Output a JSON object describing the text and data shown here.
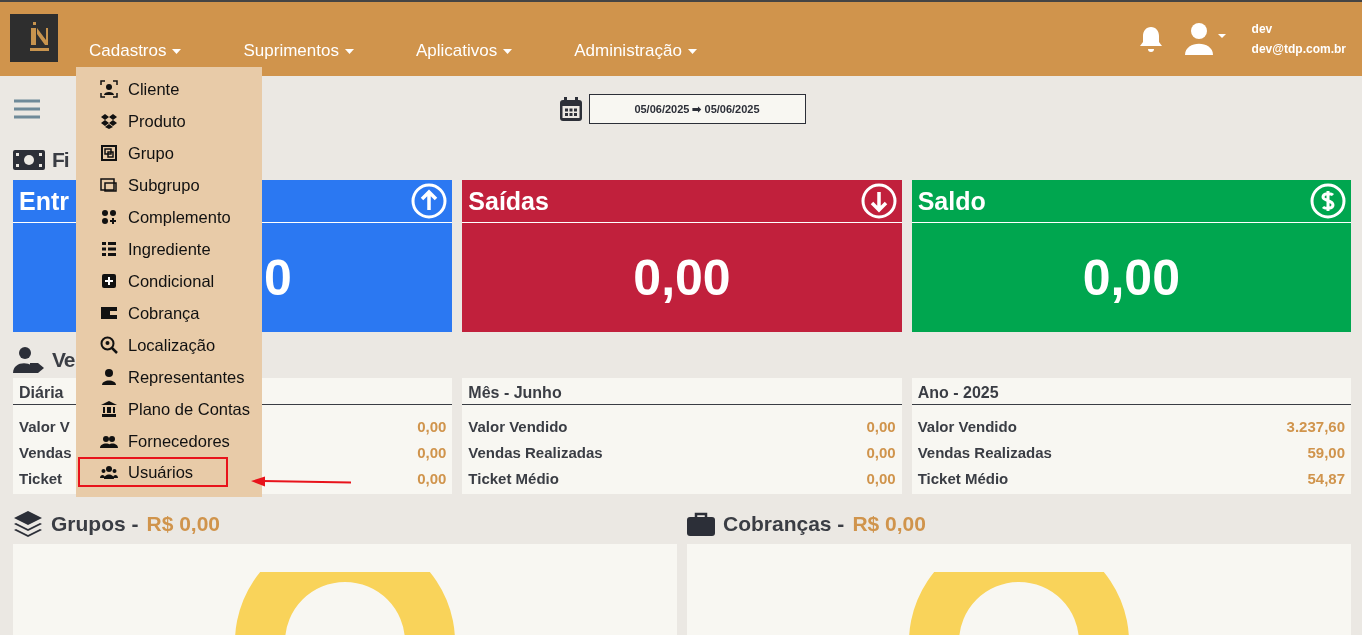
{
  "header": {
    "nav": [
      {
        "label": "Cadastros"
      },
      {
        "label": "Suprimentos"
      },
      {
        "label": "Aplicativos"
      },
      {
        "label": "Administração"
      }
    ],
    "user": {
      "name": "dev",
      "email": "dev@tdp.com.br"
    }
  },
  "menu": {
    "items": [
      {
        "label": "Cliente",
        "highlighted": false
      },
      {
        "label": "Produto",
        "highlighted": false
      },
      {
        "label": "Grupo",
        "highlighted": false
      },
      {
        "label": "Subgrupo",
        "highlighted": false
      },
      {
        "label": "Complemento",
        "highlighted": false
      },
      {
        "label": "Ingrediente",
        "highlighted": false
      },
      {
        "label": "Condicional",
        "highlighted": false
      },
      {
        "label": "Cobrança",
        "highlighted": false
      },
      {
        "label": "Localização",
        "highlighted": false
      },
      {
        "label": "Representantes",
        "highlighted": false
      },
      {
        "label": "Plano de Contas",
        "highlighted": false
      },
      {
        "label": "Fornecedores",
        "highlighted": false
      },
      {
        "label": "Usuários",
        "highlighted": true
      }
    ]
  },
  "date_range": "05/06/2025 ➡ 05/06/2025",
  "finance": {
    "title": "Fi",
    "cards": [
      {
        "kind": "in",
        "title": "Entr",
        "value": "0"
      },
      {
        "kind": "out",
        "title": "Saídas",
        "value": "0,00"
      },
      {
        "kind": "balance",
        "title": "Saldo",
        "value": "0,00"
      }
    ]
  },
  "sales": {
    "title": "Ve",
    "panels": [
      {
        "title": "Diária",
        "rows": [
          {
            "label": "Valor V",
            "value": "0,00"
          },
          {
            "label": "Vendas",
            "value": "0,00"
          },
          {
            "label": "Ticket",
            "value": "0,00"
          }
        ]
      },
      {
        "title": "Mês - Junho",
        "rows": [
          {
            "label": "Valor Vendido",
            "value": "0,00"
          },
          {
            "label": "Vendas Realizadas",
            "value": "0,00"
          },
          {
            "label": "Ticket Médio",
            "value": "0,00"
          }
        ]
      },
      {
        "title": "Ano - 2025",
        "rows": [
          {
            "label": "Valor Vendido",
            "value": "3.237,60"
          },
          {
            "label": "Vendas Realizadas",
            "value": "59,00"
          },
          {
            "label": "Ticket Médio",
            "value": "54,87"
          }
        ]
      }
    ]
  },
  "charts": [
    {
      "kind": "groups",
      "title": "Grupos -",
      "amount": "R$ 0,00"
    },
    {
      "kind": "billing",
      "title": "Cobranças -",
      "amount": "R$ 0,00"
    }
  ]
}
